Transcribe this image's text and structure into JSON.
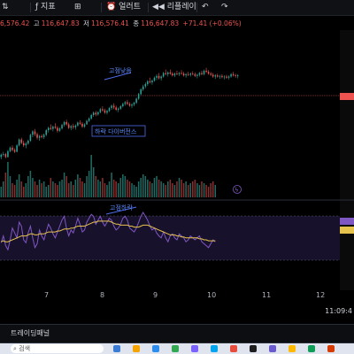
{
  "toolbar": {
    "indicators_label": "지표",
    "alert_label": "얼러트",
    "replay_label": "리플레이",
    "undo_icon": "undo-icon",
    "redo_icon": "redo-icon"
  },
  "ohlc": {
    "open_value": "6,576.42",
    "high_label": "고",
    "high_value": "116,647.83",
    "low_label": "저",
    "low_value": "116,576.41",
    "close_label": "종",
    "close_value": "116,647.83",
    "change": "+71.41 (+0.06%)"
  },
  "annotations": {
    "top": "고점낮음",
    "divergence": "하락 다이버전스",
    "rsi": "고점하락"
  },
  "time_axis": {
    "labels": [
      "7",
      "8",
      "9",
      "10",
      "11",
      "12"
    ]
  },
  "clock": "11:09:4",
  "panel_title": "트레이딩패널",
  "taskbar": {
    "search_placeholder": "검색"
  },
  "colors": {
    "up": "#26a69a",
    "down": "#ef5350",
    "price_line": "#ef5350",
    "rsi_line": "#7e57c2",
    "rsi_ma": "#e6c34d",
    "rsi_band": "#2a1c47"
  },
  "chart_data": {
    "type": "candlestick",
    "candles": [
      [
        40,
        46,
        36,
        44
      ],
      [
        44,
        49,
        41,
        45
      ],
      [
        45,
        47,
        38,
        40
      ],
      [
        40,
        52,
        39,
        50
      ],
      [
        50,
        58,
        48,
        56
      ],
      [
        56,
        60,
        50,
        52
      ],
      [
        52,
        55,
        47,
        49
      ],
      [
        49,
        62,
        48,
        60
      ],
      [
        60,
        72,
        58,
        70
      ],
      [
        70,
        73,
        62,
        64
      ],
      [
        64,
        68,
        57,
        60
      ],
      [
        60,
        66,
        55,
        63
      ],
      [
        63,
        70,
        61,
        68
      ],
      [
        68,
        80,
        66,
        78
      ],
      [
        78,
        86,
        74,
        84
      ],
      [
        84,
        88,
        76,
        79
      ],
      [
        79,
        82,
        70,
        73
      ],
      [
        73,
        78,
        68,
        76
      ],
      [
        76,
        79,
        72,
        74
      ],
      [
        74,
        80,
        71,
        78
      ],
      [
        78,
        88,
        76,
        86
      ],
      [
        86,
        92,
        82,
        90
      ],
      [
        90,
        96,
        86,
        88
      ],
      [
        88,
        94,
        84,
        92
      ],
      [
        92,
        98,
        88,
        90
      ],
      [
        90,
        93,
        82,
        85
      ],
      [
        85,
        91,
        83,
        89
      ],
      [
        89,
        97,
        87,
        95
      ],
      [
        95,
        102,
        92,
        100
      ],
      [
        100,
        104,
        94,
        96
      ],
      [
        96,
        99,
        88,
        90
      ],
      [
        90,
        95,
        86,
        93
      ],
      [
        93,
        97,
        88,
        91
      ],
      [
        91,
        96,
        87,
        94
      ],
      [
        94,
        101,
        92,
        99
      ],
      [
        99,
        103,
        95,
        97
      ],
      [
        97,
        100,
        90,
        92
      ],
      [
        92,
        98,
        90,
        96
      ],
      [
        96,
        104,
        95,
        102
      ],
      [
        102,
        108,
        100,
        106
      ],
      [
        106,
        114,
        104,
        112
      ],
      [
        112,
        118,
        109,
        116
      ],
      [
        116,
        119,
        110,
        113
      ],
      [
        113,
        118,
        111,
        117
      ],
      [
        117,
        124,
        115,
        122
      ],
      [
        122,
        127,
        118,
        120
      ],
      [
        120,
        123,
        114,
        116
      ],
      [
        116,
        121,
        113,
        119
      ],
      [
        119,
        126,
        117,
        124
      ],
      [
        124,
        130,
        121,
        128
      ],
      [
        128,
        132,
        122,
        125
      ],
      [
        125,
        128,
        119,
        121
      ],
      [
        121,
        125,
        117,
        123
      ],
      [
        123,
        129,
        121,
        127
      ],
      [
        127,
        133,
        125,
        131
      ],
      [
        131,
        136,
        128,
        134
      ],
      [
        134,
        138,
        129,
        131
      ],
      [
        131,
        134,
        126,
        128
      ],
      [
        128,
        132,
        124,
        130
      ],
      [
        130,
        135,
        127,
        133
      ],
      [
        133,
        142,
        131,
        140
      ],
      [
        140,
        150,
        138,
        148
      ],
      [
        148,
        158,
        146,
        156
      ],
      [
        156,
        164,
        153,
        161
      ],
      [
        161,
        168,
        158,
        165
      ],
      [
        165,
        172,
        162,
        170
      ],
      [
        170,
        176,
        166,
        168
      ],
      [
        168,
        173,
        164,
        171
      ],
      [
        171,
        178,
        169,
        176
      ],
      [
        176,
        182,
        172,
        179
      ],
      [
        179,
        184,
        173,
        175
      ],
      [
        175,
        180,
        171,
        178
      ],
      [
        178,
        186,
        176,
        184
      ],
      [
        184,
        190,
        180,
        182
      ],
      [
        182,
        187,
        178,
        185
      ],
      [
        185,
        190,
        181,
        183
      ],
      [
        183,
        186,
        178,
        180
      ],
      [
        180,
        185,
        177,
        183
      ],
      [
        183,
        188,
        180,
        182
      ],
      [
        182,
        186,
        179,
        184
      ],
      [
        184,
        189,
        181,
        183
      ],
      [
        183,
        186,
        178,
        180
      ],
      [
        180,
        184,
        176,
        182
      ],
      [
        182,
        186,
        179,
        181
      ],
      [
        181,
        185,
        178,
        183
      ],
      [
        183,
        187,
        180,
        182
      ],
      [
        182,
        185,
        177,
        179
      ],
      [
        179,
        183,
        175,
        181
      ],
      [
        181,
        186,
        178,
        184
      ],
      [
        184,
        188,
        180,
        182
      ],
      [
        182,
        190,
        180,
        188
      ],
      [
        188,
        193,
        184,
        186
      ],
      [
        186,
        189,
        181,
        183
      ],
      [
        183,
        186,
        179,
        181
      ],
      [
        181,
        184,
        176,
        178
      ],
      [
        178,
        182,
        174,
        180
      ],
      [
        180,
        183,
        176,
        178
      ],
      [
        178,
        181,
        174,
        179
      ],
      [
        179,
        182,
        175,
        177
      ],
      [
        177,
        180,
        173,
        178
      ],
      [
        178,
        181,
        174,
        176
      ],
      [
        176,
        180,
        173,
        178
      ],
      [
        178,
        184,
        176,
        182
      ],
      [
        182,
        186,
        178,
        180
      ],
      [
        180,
        183,
        176,
        179
      ],
      [
        179,
        182,
        175,
        180
      ]
    ],
    "volume": [
      6,
      9,
      14,
      20,
      12,
      8,
      7,
      10,
      13,
      9,
      6,
      8,
      12,
      15,
      11,
      9,
      7,
      10,
      8,
      9,
      6,
      7,
      11,
      9,
      8,
      7,
      9,
      10,
      14,
      12,
      8,
      9,
      7,
      10,
      13,
      11,
      9,
      8,
      12,
      15,
      24,
      17,
      12,
      10,
      9,
      11,
      8,
      7,
      9,
      14,
      10,
      9,
      8,
      11,
      13,
      12,
      10,
      9,
      8,
      7,
      6,
      9,
      11,
      13,
      12,
      10,
      9,
      8,
      11,
      12,
      10,
      9,
      8,
      7,
      9,
      10,
      8,
      7,
      9,
      11,
      10,
      8,
      9,
      7,
      8,
      9,
      10,
      8,
      7,
      9,
      8,
      7,
      6,
      8,
      9,
      7
    ],
    "rsi": [
      45,
      52,
      42,
      38,
      48,
      60,
      55,
      50,
      66,
      62,
      48,
      45,
      55,
      62,
      50,
      40,
      44,
      58,
      52,
      48,
      56,
      64,
      60,
      54,
      50,
      56,
      62,
      68,
      72,
      60,
      52,
      58,
      55,
      62,
      70,
      64,
      56,
      58,
      66,
      70,
      74,
      72,
      64,
      68,
      72,
      66,
      62,
      66,
      70,
      68,
      62,
      58,
      60,
      64,
      70,
      72,
      68,
      60,
      58,
      56,
      60,
      66,
      72,
      76,
      72,
      68,
      62,
      58,
      60,
      55,
      52,
      50,
      56,
      50,
      46,
      52,
      54,
      50,
      48,
      54,
      52,
      50,
      46,
      48,
      52,
      50,
      48,
      50,
      52,
      46,
      44,
      42,
      40,
      44,
      48,
      46
    ],
    "rsi_ma": [
      46,
      47,
      46,
      46,
      47,
      48,
      49,
      50,
      51,
      52,
      52,
      52,
      53,
      54,
      54,
      53,
      53,
      54,
      54,
      54,
      55,
      56,
      56,
      56,
      56,
      57,
      57,
      58,
      59,
      59,
      59,
      60,
      60,
      61,
      62,
      62,
      62,
      62,
      63,
      64,
      65,
      66,
      66,
      67,
      67,
      67,
      67,
      67,
      67,
      66,
      65,
      64,
      64,
      63,
      63,
      63,
      63,
      62,
      62,
      61,
      61,
      61,
      62,
      63,
      63,
      63,
      62,
      61,
      60,
      59,
      58,
      57,
      56,
      55,
      54,
      53,
      53,
      53,
      52,
      52,
      51,
      51,
      50,
      50,
      50,
      50,
      50,
      50,
      49,
      49,
      48,
      48,
      47,
      47,
      47,
      47
    ]
  }
}
